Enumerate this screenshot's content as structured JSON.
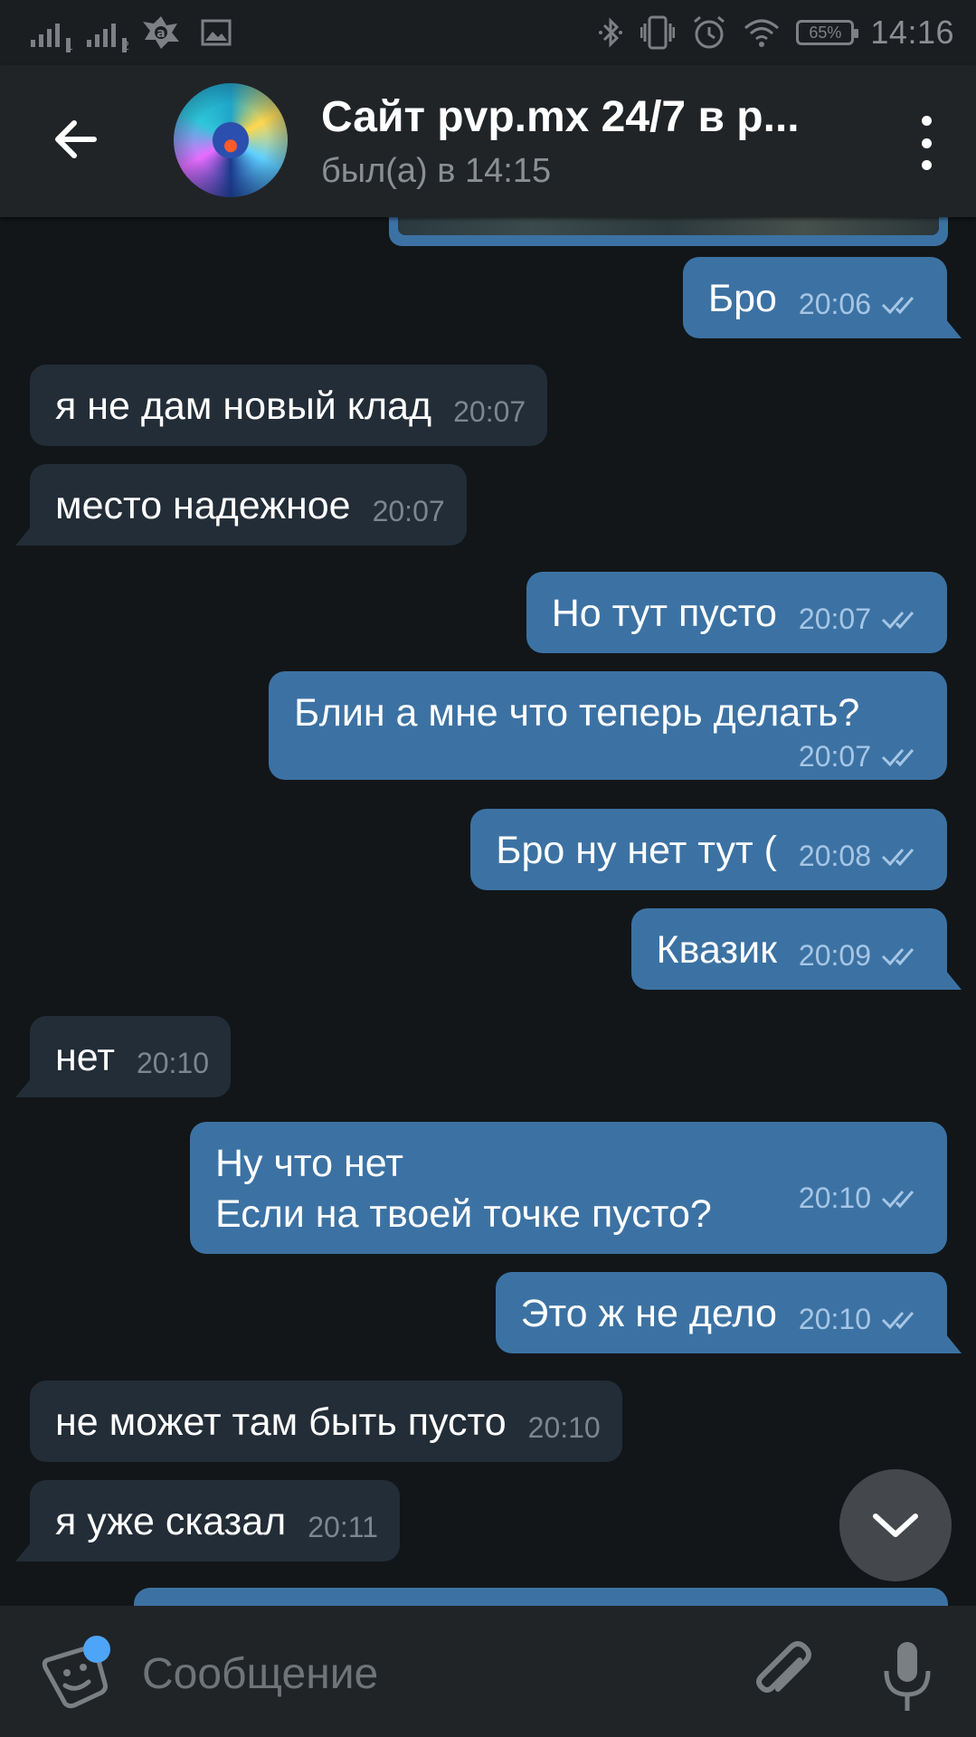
{
  "status_bar": {
    "sim1_label": "1",
    "sim2_label": "2",
    "battery": "65%",
    "time": "14:16",
    "icons": [
      "signal-icon",
      "signal-icon",
      "avast-icon",
      "gallery-icon",
      "bluetooth-icon",
      "vibrate-icon",
      "alarm-icon",
      "wifi-icon",
      "battery-icon"
    ]
  },
  "header": {
    "title": "Сайт pvp.mx 24/7 в р...",
    "status": "был(а) в 14:15"
  },
  "messages": [
    {
      "dir": "out",
      "text": "Бро",
      "time": "20:06"
    },
    {
      "dir": "in",
      "text": "я не дам новый клад",
      "time": "20:07"
    },
    {
      "dir": "in",
      "text": "место надежное",
      "time": "20:07"
    },
    {
      "dir": "out",
      "text": "Но тут пусто",
      "time": "20:07"
    },
    {
      "dir": "out",
      "text": "Блин а мне что теперь делать?",
      "time": "20:07"
    },
    {
      "dir": "out",
      "text": "Бро ну нет тут (",
      "time": "20:08"
    },
    {
      "dir": "out",
      "text": "Квазик",
      "time": "20:09"
    },
    {
      "dir": "in",
      "text": "нет",
      "time": "20:10"
    },
    {
      "dir": "out",
      "text": "Ну что нет\nЕсли на твоей точке пусто?",
      "time": "20:10"
    },
    {
      "dir": "out",
      "text": "Это ж не дело",
      "time": "20:10"
    },
    {
      "dir": "in",
      "text": "не может там быть пусто",
      "time": "20:10"
    },
    {
      "dir": "in",
      "text": "я уже сказал",
      "time": "20:11"
    }
  ],
  "input": {
    "placeholder": "Сообщение"
  },
  "colors": {
    "background": "#121619",
    "header": "#212427",
    "incoming_bubble": "#232d37",
    "outgoing_bubble": "#3c72a3",
    "incoming_time": "#7a8791",
    "outgoing_time": "#a6c6e6",
    "badge": "#4ea4f6"
  }
}
